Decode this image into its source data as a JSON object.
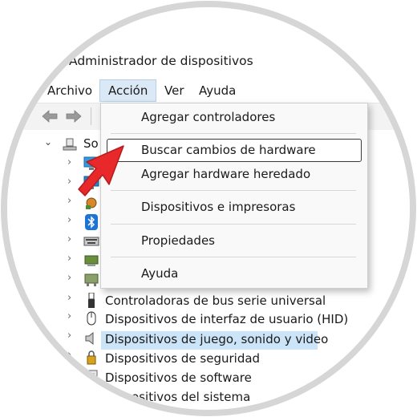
{
  "window": {
    "title": "Administrador de dispositivos"
  },
  "menubar": {
    "items": [
      {
        "id": "archivo",
        "label": "Archivo"
      },
      {
        "id": "accion",
        "label": "Acción"
      },
      {
        "id": "ver",
        "label": "Ver"
      },
      {
        "id": "ayuda",
        "label": "Ayuda"
      }
    ]
  },
  "toolbar": {
    "back_icon": "arrow-left-icon",
    "forward_icon": "arrow-right-icon"
  },
  "tree": {
    "root_label_partial": "So",
    "visible_items": [
      "Controladoras de bus serie universal",
      "Dispositivos de interfaz de usuario (HID)",
      "Dispositivos de juego, sonido y video",
      "Dispositivos de seguridad",
      "Dispositivos de software",
      "Dispositivos del sistema"
    ],
    "selected_item": "Dispositivos de juego, sonido y video"
  },
  "dropdown": {
    "items": [
      "Agregar controladores",
      "Buscar cambios de hardware",
      "Agregar hardware heredado",
      "Dispositivos e impresoras",
      "Propiedades",
      "Ayuda"
    ],
    "highlighted": "Buscar cambios de hardware"
  },
  "colors": {
    "accent_arrow": "#e8282b",
    "selection": "#cce4f7",
    "menu_active": "#dbe9f7"
  }
}
